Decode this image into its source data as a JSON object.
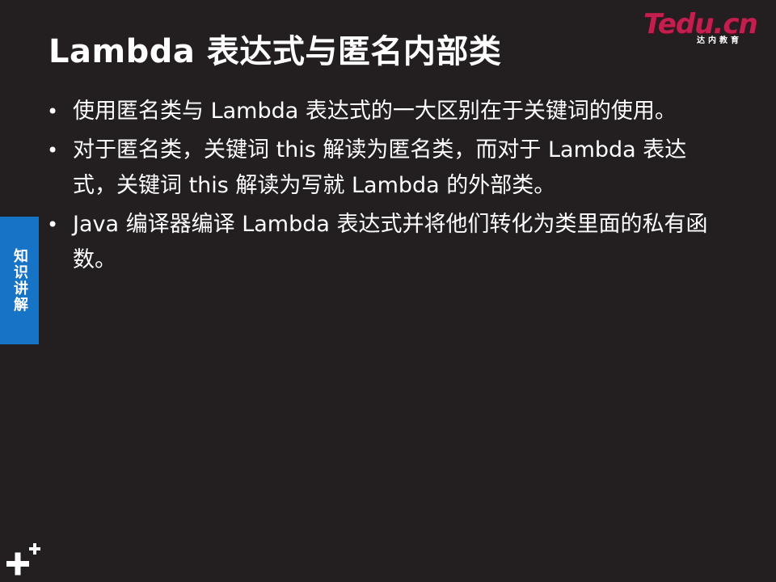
{
  "slide": {
    "title": "Lambda 表达式与匿名内部类",
    "logo": {
      "brand": "Tedu",
      "brand_suffix": ".cn",
      "subtitle": "达内教育"
    },
    "side_tab": "知识讲解",
    "bullets": [
      "使用匿名类与 Lambda 表达式的一大区别在于关键词的使用。",
      "对于匿名类，关键词 this 解读为匿名类，而对于 Lambda 表达式，关键词 this 解读为写就 Lambda 的外部类。",
      "Java 编译器编译 Lambda 表达式并将他们转化为类里面的私有函数。"
    ],
    "bullet_marker": "•"
  },
  "colors": {
    "background": "#231f20",
    "side_tab": "#1773c6",
    "logo_red": "#c21f4e",
    "text": "#ffffff"
  },
  "icons": {
    "corner": "plus-plus-icon"
  }
}
